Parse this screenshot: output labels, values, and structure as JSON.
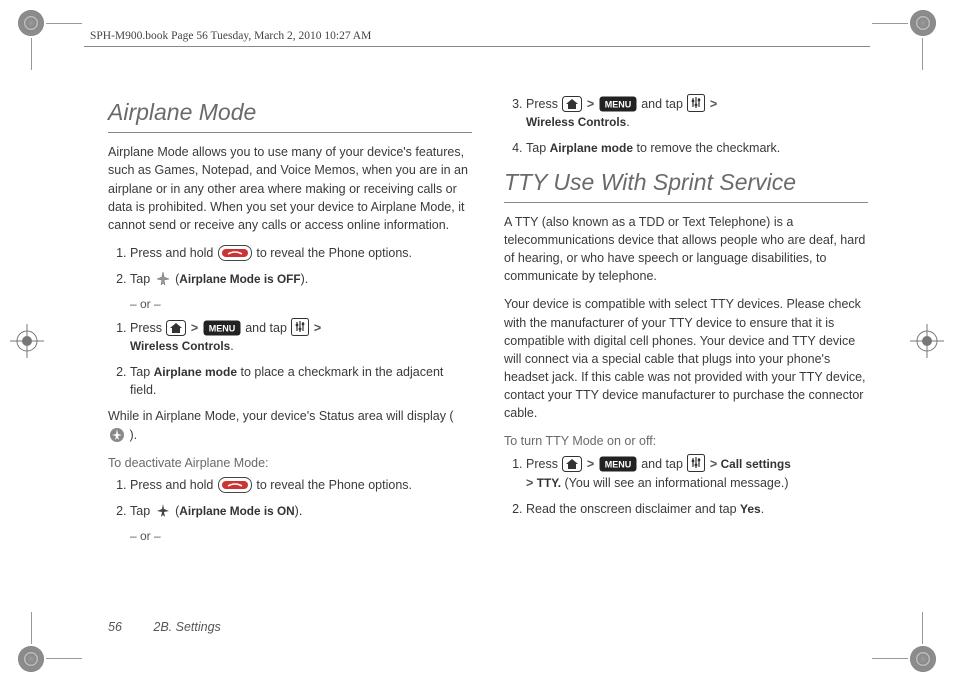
{
  "header": {
    "runner": "SPH-M900.book  Page 56  Tuesday, March 2, 2010  10:27 AM"
  },
  "left": {
    "heading": "Airplane Mode",
    "intro": "Airplane Mode allows you to use many of your device's features, such as Games, Notepad, and Voice Memos, when you are in an airplane or in any other area where making or receiving calls or data is prohibited. When you set your device to Airplane Mode, it cannot send or receive any calls or access online information.",
    "steps_a": {
      "s1_pre": "Press and hold ",
      "s1_post": " to reveal the Phone options.",
      "s2_pre": "Tap ",
      "s2_label": "Airplane Mode is OFF",
      "s2_post": ")."
    },
    "or": "– or –",
    "steps_b": {
      "s1_pre": "Press ",
      "s1_mid": " and tap ",
      "s1_label": "Wireless Controls",
      "s2_pre": "Tap ",
      "s2_bold": "Airplane mode",
      "s2_post": " to place a checkmark in the adjacent field."
    },
    "status_pre": "While in Airplane Mode, your device's Status area will display (",
    "status_post": ").",
    "deact_heading": "To deactivate Airplane Mode:",
    "steps_c": {
      "s1_pre": "Press and hold ",
      "s1_post": " to reveal the Phone options.",
      "s2_pre": "Tap ",
      "s2_label": "Airplane Mode is ON",
      "s2_post": ")."
    }
  },
  "right": {
    "steps_top": {
      "s3_pre": "Press ",
      "s3_mid": " and tap ",
      "s3_label": "Wireless Controls",
      "s4_pre": "Tap ",
      "s4_bold": "Airplane mode",
      "s4_post": " to remove the checkmark."
    },
    "heading": "TTY Use With Sprint Service",
    "p1": "A TTY (also known as a TDD or Text Telephone) is a telecommunications device that allows people who are deaf, hard of hearing, or who have speech or language disabilities, to communicate by telephone.",
    "p2": "Your device is compatible with select TTY devices. Please check with the manufacturer of your TTY device to ensure that it is compatible with digital cell phones. Your device and TTY device will connect via a special cable that plugs into your phone's headset jack. If this cable was not provided with your TTY device, contact your TTY device manufacturer to purchase the connector cable.",
    "sub": "To turn TTY Mode on or off:",
    "steps": {
      "s1_pre": "Press ",
      "s1_mid": " and tap ",
      "s1_bold1": "Call settings",
      "s1_bold2": "TTY.",
      "s1_post": " (You will see an informational message.)",
      "s2": "Read the onscreen disclaimer and tap ",
      "s2_bold": "Yes"
    }
  },
  "footer": {
    "page": "56",
    "section": "2B. Settings"
  },
  "icons": {
    "end_key": "end-call-key",
    "airplane_off": "airplane-off-icon",
    "airplane_on": "airplane-on-icon",
    "airplane_status": "airplane-status-icon",
    "home": "home-icon",
    "menu": "MENU",
    "settings": "settings-icon"
  }
}
